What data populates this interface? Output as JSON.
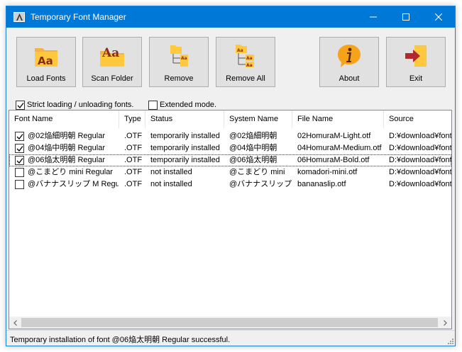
{
  "window": {
    "title": "Temporary Font Manager"
  },
  "toolbar": {
    "load_fonts": "Load Fonts",
    "scan_folder": "Scan Folder",
    "remove": "Remove",
    "remove_all": "Remove All",
    "about": "About",
    "exit": "Exit"
  },
  "options": {
    "strict_label": "Strict loading / unloading fonts.",
    "strict_checked": true,
    "extended_label": "Extended mode.",
    "extended_checked": false
  },
  "list": {
    "columns": [
      "Font Name",
      "Type",
      "Status",
      "System Name",
      "File Name",
      "Source"
    ],
    "rows": [
      {
        "checked": true,
        "font_name": "@02焔細明朝 Regular",
        "type": ".OTF",
        "status": "temporarily installed",
        "system_name": "@02焔細明朝",
        "file_name": "02HomuraM-Light.otf",
        "source": "D:¥download¥font"
      },
      {
        "checked": true,
        "font_name": "@04焔中明朝 Regular",
        "type": ".OTF",
        "status": "temporarily installed",
        "system_name": "@04焔中明朝",
        "file_name": "04HomuraM-Medium.otf",
        "source": "D:¥download¥font"
      },
      {
        "checked": true,
        "font_name": "@06焔太明朝 Regular",
        "type": ".OTF",
        "status": "temporarily installed",
        "system_name": "@06焔太明朝",
        "file_name": "06HomuraM-Bold.otf",
        "source": "D:¥download¥font"
      },
      {
        "checked": false,
        "font_name": "@こまどり mini Regular",
        "type": ".OTF",
        "status": "not installed",
        "system_name": "@こまどり mini",
        "file_name": "komadori-mini.otf",
        "source": "D:¥download¥font"
      },
      {
        "checked": false,
        "font_name": "@バナナスリップ M Regular",
        "type": ".OTF",
        "status": "not installed",
        "system_name": "@バナナスリップ M",
        "file_name": "bananaslip.otf",
        "source": "D:¥download¥font"
      }
    ]
  },
  "status": {
    "text": "Temporary installation of font @06焔太明朝 Regular successful."
  },
  "colors": {
    "titlebar": "#0078d7",
    "accent_orange": "#f7a21b",
    "folder_yellow": "#ffc83d",
    "exit_red": "#c0392b"
  }
}
